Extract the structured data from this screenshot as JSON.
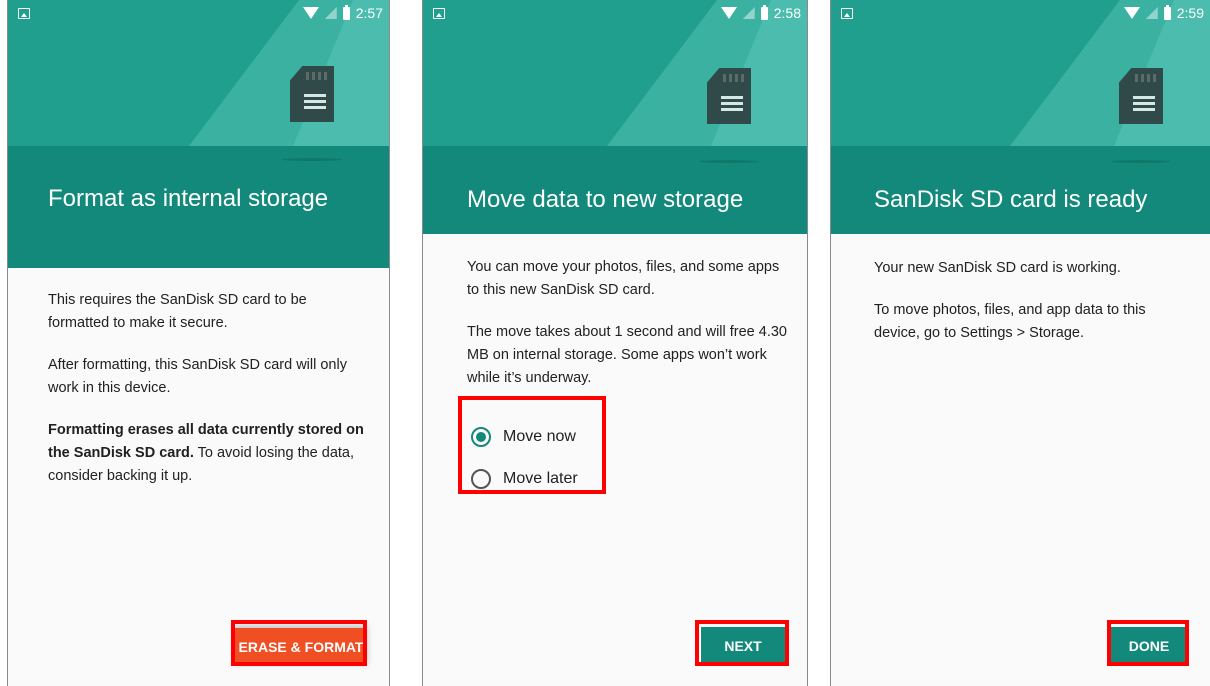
{
  "screens": [
    {
      "time": "2:57",
      "title": "Format as internal storage",
      "paragraphs": [
        "This requires the SanDisk SD card to be formatted to make it secure.",
        "After formatting, this SanDisk SD card will only work in this device."
      ],
      "warning_bold": "Formatting erases all data currently stored on the SanDisk SD card.",
      "warning_rest": " To avoid losing the data, consider backing it up.",
      "button": "ERASE & FORMAT"
    },
    {
      "time": "2:58",
      "title": "Move data to new storage",
      "paragraphs": [
        "You can move your photos, files, and some apps to this new SanDisk SD card.",
        "The move takes about 1 second and will free 4.30 MB on internal storage. Some apps won’t work while it’s underway."
      ],
      "options": [
        {
          "label": "Move now",
          "selected": true
        },
        {
          "label": "Move later",
          "selected": false
        }
      ],
      "button": "NEXT"
    },
    {
      "time": "2:59",
      "title": "SanDisk SD card is ready",
      "paragraphs": [
        "Your new SanDisk SD card is working.",
        "To move photos, files, and app data to this device, go to Settings > Storage."
      ],
      "button": "DONE"
    }
  ],
  "colors": {
    "teal": "#12897a",
    "orange": "#f04e23",
    "highlight": "#ff0000"
  },
  "icons": [
    "image-notification-icon",
    "wifi-icon",
    "signal-icon",
    "battery-icon",
    "sd-card-icon"
  ]
}
